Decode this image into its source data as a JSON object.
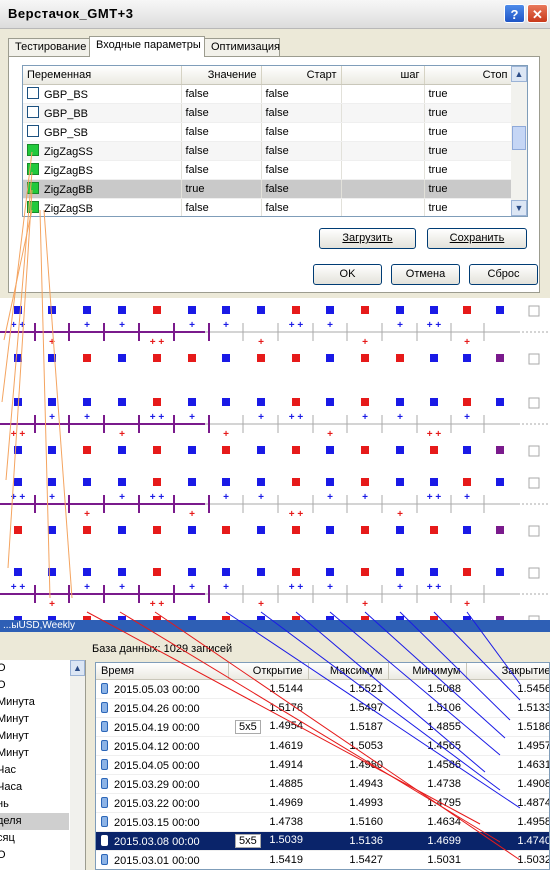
{
  "dialog": {
    "title": "Верстачок_GMT+3",
    "help": "?",
    "close": "✕",
    "tabs": [
      "Тестирование",
      "Входные параметры",
      "Оптимизация"
    ],
    "grid": {
      "headers": [
        "Переменная",
        "Значение",
        "Старт",
        "шаг",
        "Стоп"
      ],
      "rows": [
        {
          "name": "GBP_BS",
          "value": "false",
          "start": "false",
          "step": "",
          "stop": "true",
          "checked": false
        },
        {
          "name": "GBP_BB",
          "value": "false",
          "start": "false",
          "step": "",
          "stop": "true",
          "checked": false
        },
        {
          "name": "GBP_SB",
          "value": "false",
          "start": "false",
          "step": "",
          "stop": "true",
          "checked": false
        },
        {
          "name": "ZigZagSS",
          "value": "false",
          "start": "false",
          "step": "",
          "stop": "true",
          "checked": true
        },
        {
          "name": "ZigZagBS",
          "value": "false",
          "start": "false",
          "step": "",
          "stop": "true",
          "checked": true
        },
        {
          "name": "ZigZagBB",
          "value": "true",
          "start": "false",
          "step": "",
          "stop": "true",
          "checked": true
        },
        {
          "name": "ZigZagSB",
          "value": "false",
          "start": "false",
          "step": "",
          "stop": "true",
          "checked": true
        }
      ]
    },
    "load_label": "Загрузить",
    "save_label": "Сохранить",
    "ok_label": "OK",
    "cancel_label": "Отмена",
    "reset_label": "Сброс"
  },
  "diagram": {
    "colors": {
      "blue": "#1a1ae6",
      "red": "#e61a1a",
      "purple": "#7a1a8c",
      "gray": "#aaaaaa",
      "orange": "#f4a460"
    }
  },
  "bottom": {
    "title_fragment": "...ыUSD,Weekly",
    "db_info": "База данных: 1029 записей",
    "left_items": [
      "O",
      "O",
      "Минута",
      "Минут",
      "Минут",
      "Минут",
      "Час",
      "Часа",
      "нь",
      "деля",
      "сяц",
      "O"
    ],
    "left_selected_index": 9,
    "headers": [
      "Время",
      "Открытие",
      "Максимум",
      "Минимум",
      "Закрытие"
    ],
    "rows": [
      {
        "time": "2015.05.03 00:00",
        "tag": "",
        "open": "1.5144",
        "high": "1.5521",
        "low": "1.5088",
        "close": "1.5456"
      },
      {
        "time": "2015.04.26 00:00",
        "tag": "",
        "open": "1.5176",
        "high": "1.5497",
        "low": "1.5106",
        "close": "1.5133"
      },
      {
        "time": "2015.04.19 00:00",
        "tag": "5x5",
        "open": "1.4954",
        "high": "1.5187",
        "low": "1.4855",
        "close": "1.5186"
      },
      {
        "time": "2015.04.12 00:00",
        "tag": "",
        "open": "1.4619",
        "high": "1.5053",
        "low": "1.4565",
        "close": "1.4957"
      },
      {
        "time": "2015.04.05 00:00",
        "tag": "",
        "open": "1.4914",
        "high": "1.4980",
        "low": "1.4586",
        "close": "1.4631"
      },
      {
        "time": "2015.03.29 00:00",
        "tag": "",
        "open": "1.4885",
        "high": "1.4943",
        "low": "1.4738",
        "close": "1.4908"
      },
      {
        "time": "2015.03.22 00:00",
        "tag": "",
        "open": "1.4969",
        "high": "1.4993",
        "low": "1.4795",
        "close": "1.4874"
      },
      {
        "time": "2015.03.15 00:00",
        "tag": "",
        "open": "1.4738",
        "high": "1.5160",
        "low": "1.4634",
        "close": "1.4958"
      },
      {
        "time": "2015.03.08 00:00",
        "tag": "5x5",
        "open": "1.5039",
        "high": "1.5136",
        "low": "1.4699",
        "close": "1.4740"
      },
      {
        "time": "2015.03.01 00:00",
        "tag": "",
        "open": "1.5419",
        "high": "1.5427",
        "low": "1.5031",
        "close": "1.5032"
      }
    ],
    "selected_row": 8
  }
}
